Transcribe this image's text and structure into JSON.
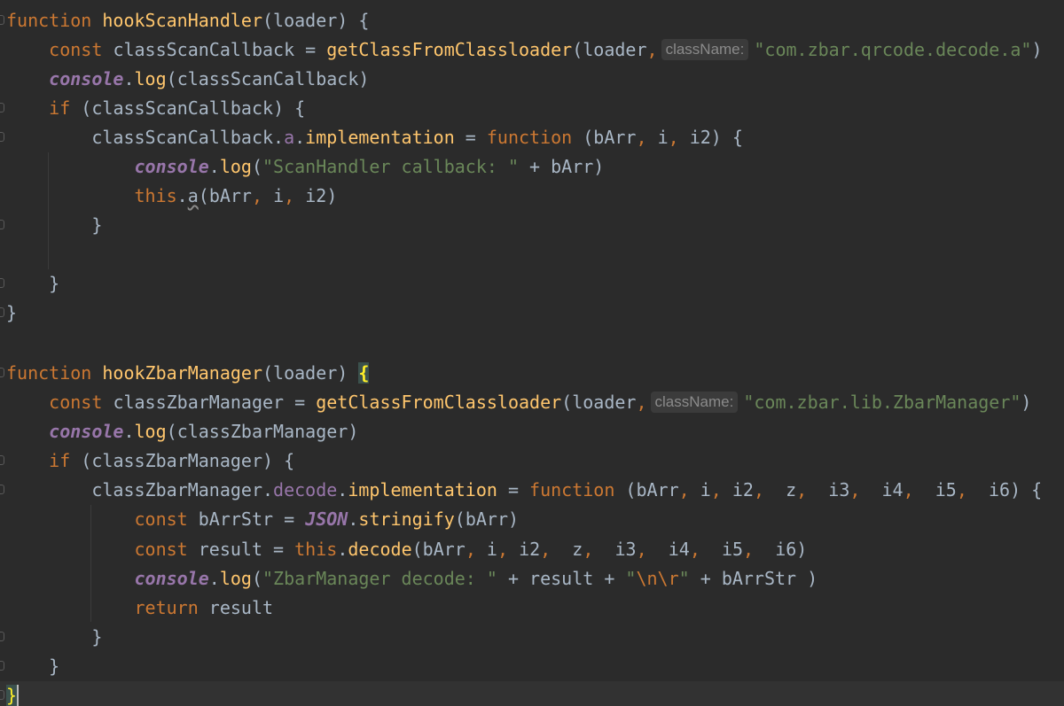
{
  "editor": {
    "keywords": {
      "function": "function",
      "const": "const",
      "if": "if",
      "this": "this",
      "return": "return"
    },
    "identifiers": {
      "hookScanHandler": "hookScanHandler",
      "hookZbarManager": "hookZbarManager",
      "loader": "loader",
      "classScanCallback": "classScanCallback",
      "classZbarManager": "classZbarManager",
      "getClassFromClassloader": "getClassFromClassloader",
      "console": "console",
      "log": "log",
      "a": "a",
      "implementation": "implementation",
      "decode": "decode",
      "bArr": "bArr",
      "i": "i",
      "i2": "i2",
      "z": "z",
      "i3": "i3",
      "i4": "i4",
      "i5": "i5",
      "i6": "i6",
      "bArrStr": "bArrStr",
      "JSON": "JSON",
      "stringify": "stringify",
      "result": "result"
    },
    "hints": {
      "className": "className:"
    },
    "strings": {
      "qrcode_class": "\"com.zbar.qrcode.decode.a\"",
      "zbar_class": "\"com.zbar.lib.ZbarManager\"",
      "scan_msg": "\"ScanHandler callback: \"",
      "decode_msg": "\"ZbarManager decode: \"",
      "escape_open": "\"",
      "escape_seq": "\\n\\r",
      "escape_close": "\""
    }
  }
}
